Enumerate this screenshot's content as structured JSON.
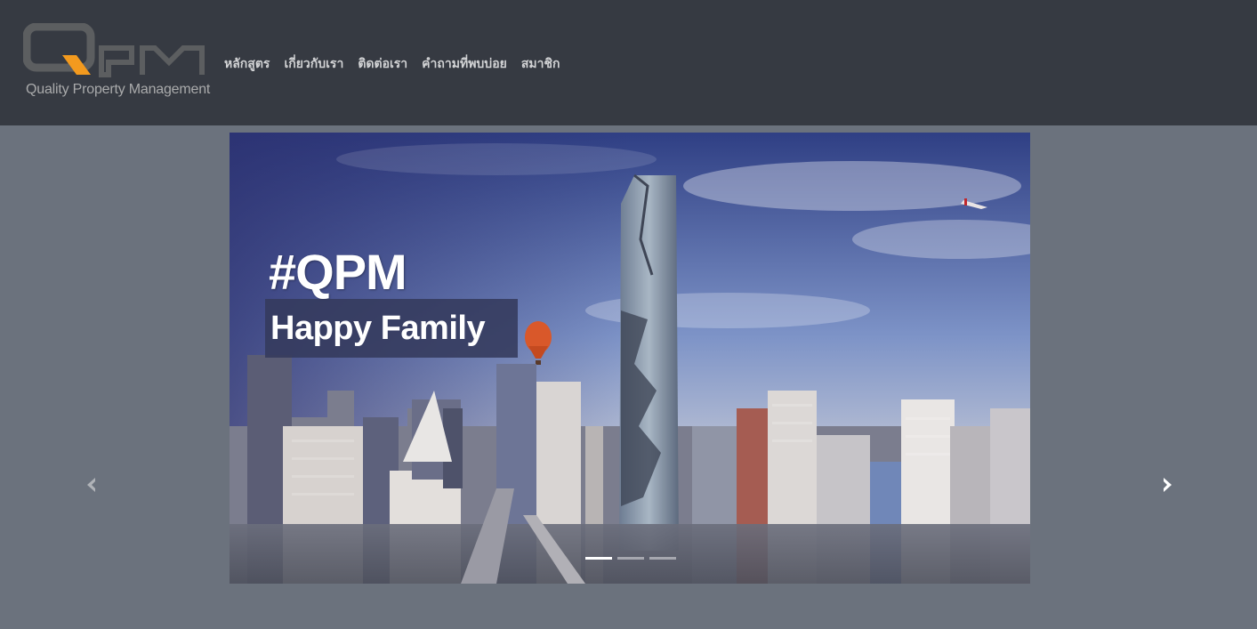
{
  "brand": {
    "tagline": "Quality Property Management",
    "colors": {
      "logo_gray": "#5c5e60",
      "logo_orange": "#f39a1e"
    }
  },
  "nav": {
    "items": [
      {
        "label": "หลักสูตร"
      },
      {
        "label": "เกี่ยวกับเรา"
      },
      {
        "label": "ติดต่อเรา"
      },
      {
        "label": "คำถามที่พบบ่อย"
      },
      {
        "label": "สมาชิก"
      }
    ]
  },
  "carousel": {
    "slide": {
      "hashtag": "#QPM",
      "tagline": "Happy Family"
    },
    "slide_count": 3,
    "active_index": 0,
    "prev_icon": "chevron-left-icon",
    "next_icon": "chevron-right-icon"
  },
  "colors": {
    "navbar": "#363a42",
    "page_bg": "#6b727d",
    "nav_text": "#d2d3d5"
  }
}
